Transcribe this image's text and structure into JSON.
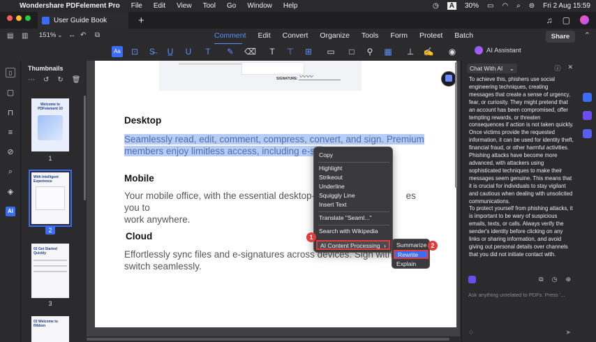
{
  "menubar": {
    "app_name": "Wondershare PDFelement Pro",
    "items": [
      "File",
      "Edit",
      "View",
      "Tool",
      "Go",
      "Window",
      "Help"
    ],
    "battery": "30%",
    "datetime": "Fri 2 Aug  15:59"
  },
  "tab": {
    "title": "User Guide Book"
  },
  "toolbar": {
    "zoom": "151%",
    "menu_tabs": [
      "Comment",
      "Edit",
      "Convert",
      "Organize",
      "Tools",
      "Form",
      "Protect",
      "Batch"
    ],
    "share": "Share",
    "ai_assistant": "AI Assistant"
  },
  "thumbnails": {
    "title": "Thumbnails",
    "pages": [
      {
        "label": "1",
        "caption": "Welcome to PDFelement 10"
      },
      {
        "label": "2",
        "caption": "With Intelligent Experience"
      },
      {
        "label": "3",
        "caption": "02 Get Started Quickly"
      },
      {
        "label": "",
        "caption": "03 Welcome to Ribbon"
      }
    ]
  },
  "document": {
    "sections": [
      {
        "heading": "Desktop",
        "body": "Seamlessly read, edit, comment, compress, convert, and sign. Premium members enjoy limitless access, including e-sig"
      },
      {
        "heading": "Mobile",
        "body_start": "Your mobile office, with the essential desktop-le",
        "body_end": "es you to",
        "body_line2": "work anywhere."
      },
      {
        "heading": "Cloud",
        "body_start": "Effortlessly sync files and e-signatures across devices. Sign withou",
        "body_line2": "switch seamlessly."
      }
    ],
    "signature_label": "SIGNATURE:"
  },
  "context_menu": {
    "items": [
      "Copy",
      "Highlight",
      "Strikeout",
      "Underline",
      "Squiggly Line",
      "Insert Text",
      "Translate \"Seaml...\"",
      "Search with Wikipedia",
      "AI Content Processing"
    ],
    "submenu": [
      "Summarize",
      "Rewrite",
      "Explain"
    ],
    "badge1": "1",
    "badge2": "2"
  },
  "chat": {
    "mode": "Chat With AI",
    "paragraphs": [
      "To achieve this, phishers use social engineering techniques, creating messages that create a sense of urgency, fear, or curiosity. They might pretend that an account has been compromised, offer tempting rewards, or threaten consequences if action is not taken quickly. Once victims provide the requested information, it can be used for identity theft, financial fraud, or other harmful activities.",
      "Phishing attacks have become more advanced, with attackers using sophisticated techniques to make their messages seem genuine. This means that it is crucial for individuals to stay vigilant and cautious when dealing with unsolicited communications.",
      "To protect yourself from phishing attacks, it is important to be wary of suspicious emails, texts, or calls. Always verify the sender's identity before clicking on any links or sharing information, and avoid giving out personal details over channels that you did not initiate contact with."
    ],
    "input_placeholder": "Ask anything unrelated to PDFs. Press '..."
  },
  "colors": {
    "accent": "#5b8ff9",
    "highlight": "#b8cdf5",
    "badge": "#e23b3b"
  }
}
